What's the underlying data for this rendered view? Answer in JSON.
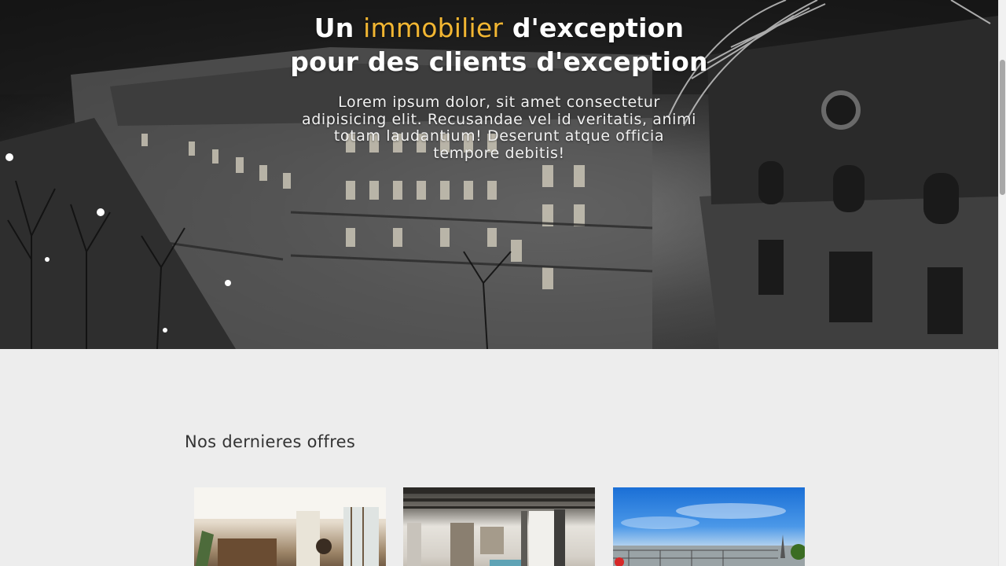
{
  "hero": {
    "title_part1": "Un ",
    "title_accent": "immobilier",
    "title_part2": " d'exception",
    "title_line2": "pour des clients d'exception",
    "lead": "Lorem ipsum dolor, sit amet consectetur adipisicing elit. Recusandae vel id veritatis, animi totam laudantium! Deserunt atque officia tempore debitis!",
    "background_image": "paris-buildings-eiffel-tower-bw-photo",
    "accent_color": "#f2b632"
  },
  "offers": {
    "heading": "Nos dernieres offres",
    "cards": [
      {
        "image": "living-room-photo"
      },
      {
        "image": "white-interior-photo"
      },
      {
        "image": "paris-rooftop-view-photo"
      }
    ]
  }
}
